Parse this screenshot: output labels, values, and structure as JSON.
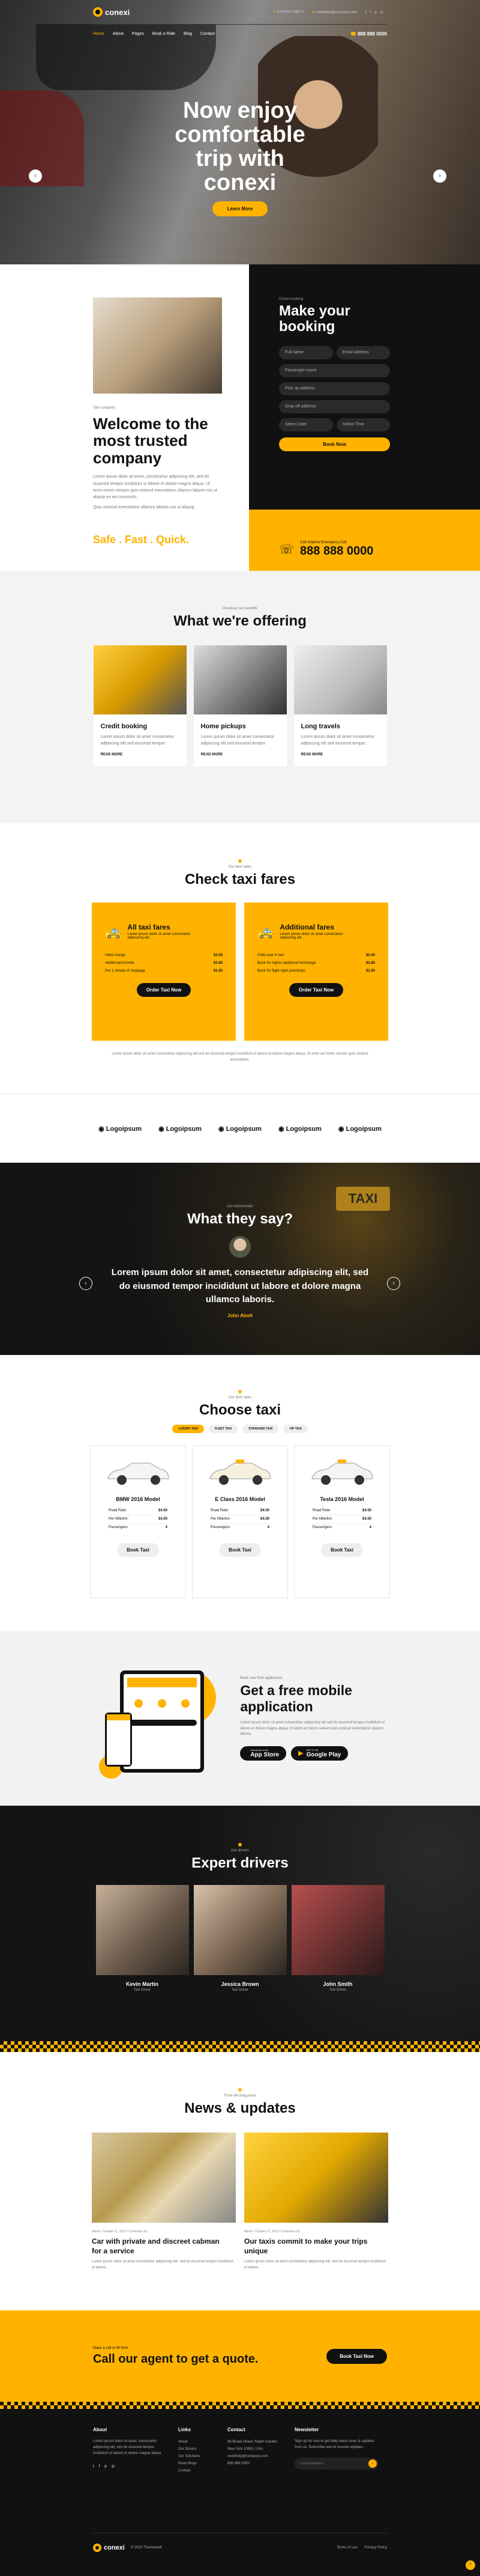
{
  "brand": {
    "name": "conexi",
    "accent": "#ffb300",
    "dark": "#111111"
  },
  "header": {
    "support_label": "Customer Sign in",
    "email": "needhelp@company.com",
    "phone": "888 888 0000",
    "nav": [
      "Home",
      "About",
      "Pages",
      "Book a Ride",
      "Blog",
      "Contact"
    ]
  },
  "hero": {
    "title_l1": "Now enjoy",
    "title_l2": "comfortable",
    "title_l3": "trip with",
    "title_l4": "conexi",
    "button": "Learn More"
  },
  "welcome": {
    "kicker": "Taxi company",
    "title_l1": "Welcome to the",
    "title_l2": "most trusted",
    "title_l3": "company",
    "text1": "Lorem ipsum dolor sit amet, consectetur adipiscing elit, sed do eiusmod tempor incididunt ut labore et dolore magna aliqua. Ut enim minim veniam quis nostrud exercitation ullamco laboris nisi ut aliquip ex ea commodo.",
    "text2": "Quis nostrud exercitation ullamco laboris nisi ut aliquip.",
    "tagline": "Safe . Fast . Quick."
  },
  "booking": {
    "kicker": "Online booking",
    "title_l1": "Make your",
    "title_l2": "booking",
    "fields": [
      "Full name",
      "Email address",
      "Passenger count",
      "Pick up address",
      "Drop off address",
      "Select Date",
      "Select Time"
    ],
    "button": "Book Now",
    "call_label": "Call Anytime Emergency Call",
    "call_number": "888 888 0000"
  },
  "offering": {
    "kicker": "Checkout our benefits",
    "title": "What we're offering",
    "cards": [
      {
        "title": "Credit booking",
        "text": "Lorem ipsum dolor sit amet consectetur adipiscing elit sed eiusmod tempor.",
        "link": "READ MORE"
      },
      {
        "title": "Home pickups",
        "text": "Lorem ipsum dolor sit amet consectetur adipiscing elit sed eiusmod tempor.",
        "link": "READ MORE"
      },
      {
        "title": "Long travels",
        "text": "Lorem ipsum dolor sit amet consectetur adipiscing elit sed eiusmod tempor.",
        "link": "READ MORE"
      }
    ]
  },
  "fares": {
    "kicker": "Our best rates",
    "title": "Check taxi fares",
    "cards": [
      {
        "title": "All taxi fares",
        "sub": "Lorem ipsum dolor sit amet consectetur adipiscing elit.",
        "rows": [
          [
            "Initial charge",
            "$2.50"
          ],
          [
            "Additional km/mile",
            "$3.80"
          ],
          [
            "Per 1 minute of stoppage",
            "$1.50"
          ]
        ],
        "button": "Order Taxi Now"
      },
      {
        "title": "Additional fares",
        "sub": "Lorem ipsum dolor sit amet consectetur adipiscing elit.",
        "rows": [
          [
            "Child seat in taxi",
            "$2.50"
          ],
          [
            "Book for higher additional km/charge",
            "$3.80"
          ],
          [
            "Book for flight night pick/drops",
            "$1.50"
          ]
        ],
        "button": "Order Taxi Now"
      }
    ],
    "note": "Lorem ipsum dolor sit amet consectetur adipiscing elit sed do eiusmod tempor incididunt ut labore et dolore magna aliqua. Ut enim ad minim veniam quis nostrud exercitation."
  },
  "logos": [
    "Logoipsum",
    "Logoipsum",
    "Logoipsum",
    "Logoipsum",
    "Logoipsum"
  ],
  "testimonial": {
    "kicker": "Our testimonials",
    "title": "What they say?",
    "quote_l1": "Lorem ipsum dolor sit amet, consectetur adipiscing elit, sed",
    "quote_l2": "do eiusmod tempor incididunt ut labore et dolore magna",
    "quote_l3": "ullamco laboris.",
    "author": "John Abott"
  },
  "choose": {
    "kicker": "Our best rates",
    "title": "Choose taxi",
    "tabs": [
      "LUXURY TAXI",
      "FLEET TAXI",
      "STANDARD TAXI",
      "VIP TAXI"
    ],
    "cars": [
      {
        "name": "BMW 2016 Model",
        "rows": [
          [
            "Road Rate:",
            "$4.50"
          ],
          [
            "Per Mile/km:",
            "$4.50"
          ],
          [
            "Passengers:",
            "4"
          ]
        ],
        "button": "Book Taxi"
      },
      {
        "name": "E Class 2016 Model",
        "rows": [
          [
            "Road Rate:",
            "$4.50"
          ],
          [
            "Per Mile/km:",
            "$4.50"
          ],
          [
            "Passengers:",
            "4"
          ]
        ],
        "button": "Book Taxi"
      },
      {
        "name": "Tesla 2016 Model",
        "rows": [
          [
            "Road Rate:",
            "$4.50"
          ],
          [
            "Per Mile/km:",
            "$4.50"
          ],
          [
            "Passengers:",
            "4"
          ]
        ],
        "button": "Book Taxi"
      }
    ]
  },
  "app": {
    "kicker": "Book now from application",
    "title_l1": "Get a free mobile",
    "title_l2": "application",
    "text": "Lorem ipsum dolor sit amet consectetur adipiscing elit sed do eiusmod tempor incididunt ut labore et dolore magna aliqua. Ut enim ad minim veniam quis nostrud exercitation ullamco laboris.",
    "store1_small": "Download on the",
    "store1": "App Store",
    "store2_small": "GET IT ON",
    "store2": "Google Play"
  },
  "drivers": {
    "kicker": "Our drivers",
    "title": "Expert drivers",
    "people": [
      {
        "name": "Kevin Martin",
        "role": "Taxi Driver"
      },
      {
        "name": "Jessica Brown",
        "role": "Taxi Driver"
      },
      {
        "name": "John Smith",
        "role": "Taxi Driver"
      }
    ]
  },
  "news": {
    "kicker": "From the blog posts",
    "title": "News & updates",
    "posts": [
      {
        "meta": "Admin  /  October 17, 2019  /  Comments (0)",
        "title_l1": "Car with private and discreet cabman",
        "title_l2": "for a service",
        "text": "Lorem ipsum dolor sit amet consectetur adipiscing elit, sed do eiusmod tempor incididunt ut labore."
      },
      {
        "meta": "Admin  /  October 17, 2019  /  Comments (0)",
        "title_l1": "Our taxis commit to make your trips",
        "title_l2": "unique",
        "text": "Lorem ipsum dolor sit amet consectetur adipiscing elit, sed do eiusmod tempor incididunt ut labore."
      }
    ]
  },
  "cta": {
    "kicker": "Make a call or fill form",
    "title": "Call our agent to get a quote.",
    "button": "Book Taxi Now"
  },
  "footer": {
    "about_title": "About",
    "about_text": "Lorem ipsum dolor sit amet, consectetur adipiscing elit, sed do eiusmod tempor incididunt ut labore et dolore magna aliqua.",
    "links_title": "Links",
    "links": [
      "About",
      "Our Drivers",
      "Our Solutions",
      "Read Blogs",
      "Contact"
    ],
    "contact_title": "Contact",
    "contact": [
      "86 Broad Street, Ralph Garden",
      "New York 10061, USA",
      "needhelp@company.com",
      "888 888 0000"
    ],
    "news_title": "Newsletter",
    "news_text": "Sign up for now to get daily latest news & updates from us. Subscribe now to receive updates.",
    "news_placeholder": "Email address",
    "copyright": "© 2020 Themeskell",
    "links_bottom": [
      "Terms of use",
      "Privacy Policy"
    ]
  }
}
